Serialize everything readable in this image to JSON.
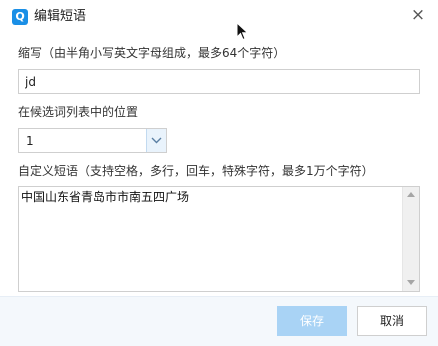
{
  "dialog": {
    "title": "编辑短语",
    "app_icon_letter": "Q",
    "close_label": "×"
  },
  "form": {
    "abbr_label": "缩写（由半角小写英文字母组成，最多64个字符）",
    "abbr_value": "jd",
    "position_label": "在候选词列表中的位置",
    "position_value": "1",
    "phrase_label": "自定义短语（支持空格，多行，回车，特殊字符，最多1万个字符）",
    "phrase_value": "中国山东省青岛市市南五四广场"
  },
  "footer": {
    "save_label": "保存",
    "cancel_label": "取消"
  },
  "colors": {
    "accent": "#1a8fe6",
    "save_disabled": "#a9d3f5",
    "footer_bg": "#f4f8fc"
  },
  "icons": [
    "app-logo-icon",
    "close-icon",
    "chevron-down-icon",
    "scroll-up-arrow-icon",
    "scroll-down-arrow-icon",
    "mouse-cursor-icon"
  ]
}
